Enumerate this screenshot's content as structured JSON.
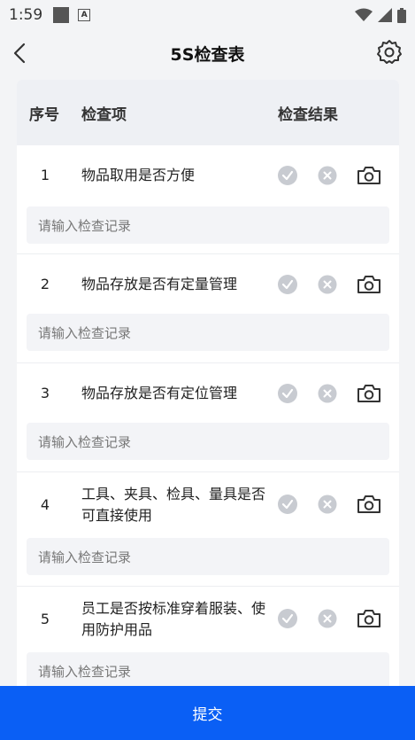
{
  "status_bar": {
    "time": "1:59"
  },
  "header": {
    "title": "5S检查表"
  },
  "table": {
    "col_no": "序号",
    "col_item": "检查项",
    "col_result": "检查结果",
    "rows": [
      {
        "no": "1",
        "item": "物品取用是否方便",
        "note_placeholder": "请输入检查记录"
      },
      {
        "no": "2",
        "item": "物品存放是否有定量管理",
        "note_placeholder": "请输入检查记录"
      },
      {
        "no": "3",
        "item": "物品存放是否有定位管理",
        "note_placeholder": "请输入检查记录"
      },
      {
        "no": "4",
        "item": "工具、夹具、检具、量具是否可直接使用",
        "note_placeholder": "请输入检查记录"
      },
      {
        "no": "5",
        "item": "员工是否按标准穿着服装、使用防护用品",
        "note_placeholder": "请输入检查记录"
      }
    ]
  },
  "footer": {
    "submit_label": "提交"
  },
  "colors": {
    "primary": "#0a5ff5",
    "icon_gray": "#c8cbd1"
  }
}
